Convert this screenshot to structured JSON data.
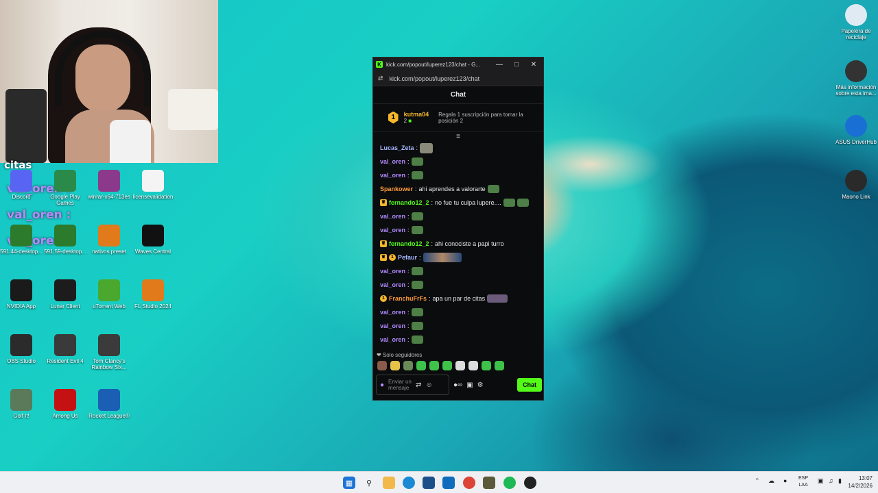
{
  "overlay": {
    "citas": "citas",
    "names": [
      "val_oren :",
      "val_oren :",
      "val_oren :"
    ]
  },
  "desktop_left": [
    {
      "label": "Discord",
      "icon": "discord-icon",
      "color": "#5865f2"
    },
    {
      "label": "Google Play Games",
      "icon": "google-play-games-icon",
      "color": "#2a8a4a"
    },
    {
      "label": "winrar-x64-713es",
      "icon": "winrar-icon",
      "color": "#8b3a8b"
    },
    {
      "label": "licensevalidation",
      "icon": "document-icon",
      "color": "#f4f4f4"
    },
    {
      "label": "591.44-desktop...",
      "icon": "nvidia-installer-icon",
      "color": "#2c7a2c"
    },
    {
      "label": "591.59-desktop...",
      "icon": "nvidia-installer-icon",
      "color": "#2c7a2c"
    },
    {
      "label": "nativos preset",
      "icon": "fl-studio-icon",
      "color": "#e07a1a"
    },
    {
      "label": "Waves Central",
      "icon": "waves-icon",
      "color": "#111111"
    },
    {
      "label": "NVIDIA App",
      "icon": "nvidia-icon",
      "color": "#1a1a1a"
    },
    {
      "label": "Lunar Client",
      "icon": "lunar-client-icon",
      "color": "#1c1c1c"
    },
    {
      "label": "uTorrent Web",
      "icon": "utorrent-icon",
      "color": "#4aa82e"
    },
    {
      "label": "FL Studio 2024",
      "icon": "fl-studio-icon",
      "color": "#e07a1a"
    },
    {
      "label": "OBS Studio",
      "icon": "obs-icon",
      "color": "#2b2b2b"
    },
    {
      "label": "Resident Evil 4",
      "icon": "resident-evil-icon",
      "color": "#3a3a3a"
    },
    {
      "label": "Tom Clancy's Rainbow Six...",
      "icon": "rainbow-six-icon",
      "color": "#3b3b3b"
    },
    {
      "label": "Golf It!",
      "icon": "golf-it-icon",
      "color": "#5a7a5a"
    },
    {
      "label": "Among Us",
      "icon": "among-us-icon",
      "color": "#c51111"
    },
    {
      "label": "Rocket League®",
      "icon": "rocket-league-icon",
      "color": "#1a5fb4"
    }
  ],
  "desktop_right": [
    {
      "label": "Papelera de reciclaje",
      "icon": "recycle-bin-icon",
      "color": "#dfeaf2"
    },
    {
      "label": "Más información sobre esta ima...",
      "icon": "info-camera-icon",
      "color": "#333333"
    },
    {
      "label": "ASUS DriverHub",
      "icon": "asus-driverhub-icon",
      "color": "#1a6fd4"
    },
    {
      "label": "Maono Link",
      "icon": "maono-link-icon",
      "color": "#2a2a2a"
    }
  ],
  "chat_window": {
    "title": "kick.com/popout/luperez123/chat - G...",
    "url": "kick.com/popout/luperez123/chat",
    "header": "Chat",
    "pinned": {
      "rank": "1",
      "user": "kutma04",
      "count": "2",
      "gift_text": "Regala 1 suscripción para tomar la posición 2"
    },
    "messages": [
      {
        "user": "Lucas_Zeta",
        "color": "#a7b8ff",
        "text": "",
        "emote": "img-small"
      },
      {
        "user": "val_oren",
        "color": "#b38bff",
        "text": "",
        "emote": "frog"
      },
      {
        "user": "val_oren",
        "color": "#b38bff",
        "text": "",
        "emote": "frog"
      },
      {
        "user": "Spankower",
        "color": "#ff9a3c",
        "text": "ahi aprendes a valorarte",
        "emote": "frog"
      },
      {
        "user": "fernando12_2",
        "color": "#53fc18",
        "text": "no fue tu culpa lupere....",
        "emote": "frog2",
        "badge": "crown"
      },
      {
        "user": "val_oren",
        "color": "#b38bff",
        "text": "",
        "emote": "frog"
      },
      {
        "user": "val_oren",
        "color": "#b38bff",
        "text": "",
        "emote": "frog"
      },
      {
        "user": "fernando12_2",
        "color": "#53fc18",
        "text": "ahi conociste a papi turro",
        "emote": "",
        "badge": "crown"
      },
      {
        "user": "Pefaur",
        "color": "#a7b8ff",
        "text": "",
        "emote": "img",
        "badge": "crown-gift"
      },
      {
        "user": "val_oren",
        "color": "#b38bff",
        "text": "",
        "emote": "frog"
      },
      {
        "user": "val_oren",
        "color": "#b38bff",
        "text": "",
        "emote": "frog"
      },
      {
        "user": "FranchuFrFs",
        "color": "#ff9a3c",
        "text": "apa un par de citas",
        "emote": "wide",
        "badge": "gift"
      },
      {
        "user": "val_oren",
        "color": "#b38bff",
        "text": "",
        "emote": "frog"
      },
      {
        "user": "val_oren",
        "color": "#b38bff",
        "text": "",
        "emote": "frog"
      },
      {
        "user": "val_oren",
        "color": "#b38bff",
        "text": "",
        "emote": "frog"
      }
    ],
    "followers_only": "Solo seguidores",
    "input_placeholder": "Enviar un mensaje",
    "chat_button": "Chat"
  },
  "taskbar": {
    "language": "ESP",
    "layout": "LAA",
    "time": "13:07",
    "date": "14/2/2026"
  }
}
